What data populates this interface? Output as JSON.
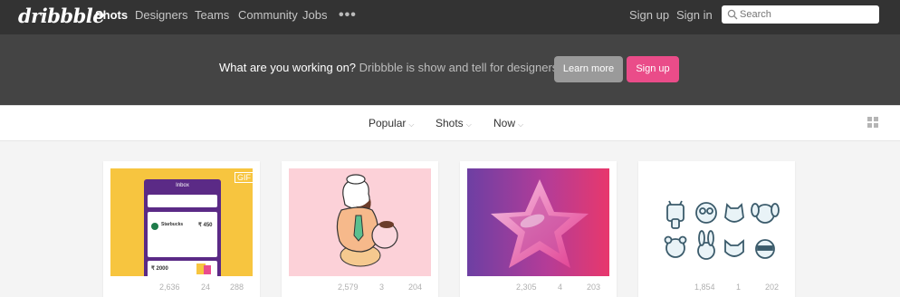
{
  "header": {
    "logo": "dribbble",
    "nav": [
      "Shots",
      "Designers",
      "Teams",
      "Community",
      "Jobs"
    ],
    "more_label": "•••",
    "signup_label": "Sign up",
    "signin_label": "Sign in",
    "search_placeholder": "Search"
  },
  "banner": {
    "question": "What are you working on?",
    "tagline": " Dribbble is show and tell for designers.",
    "learn_more_label": "Learn more",
    "signup_label": "Sign up"
  },
  "filters": {
    "items": [
      "Popular",
      "Shots",
      "Now"
    ],
    "chevron": "⌵"
  },
  "shots": [
    {
      "badge": "GIF",
      "stats": {
        "views": "2,636",
        "comments": "24",
        "likes": "288"
      },
      "ui": {
        "header": "Inbox",
        "list_title": "Starbucks",
        "amount": "₹ 450",
        "amount2": "₹ 2000"
      }
    },
    {
      "stats": {
        "views": "2,579",
        "comments": "3",
        "likes": "204"
      }
    },
    {
      "stats": {
        "views": "2,305",
        "comments": "4",
        "likes": "203"
      }
    },
    {
      "stats": {
        "views": "1,854",
        "comments": "1",
        "likes": "202"
      }
    }
  ],
  "colors": {
    "topbar": "#333333",
    "banner": "#444444",
    "accent": "#ea4c89",
    "muted_button": "#9a9a9a"
  }
}
